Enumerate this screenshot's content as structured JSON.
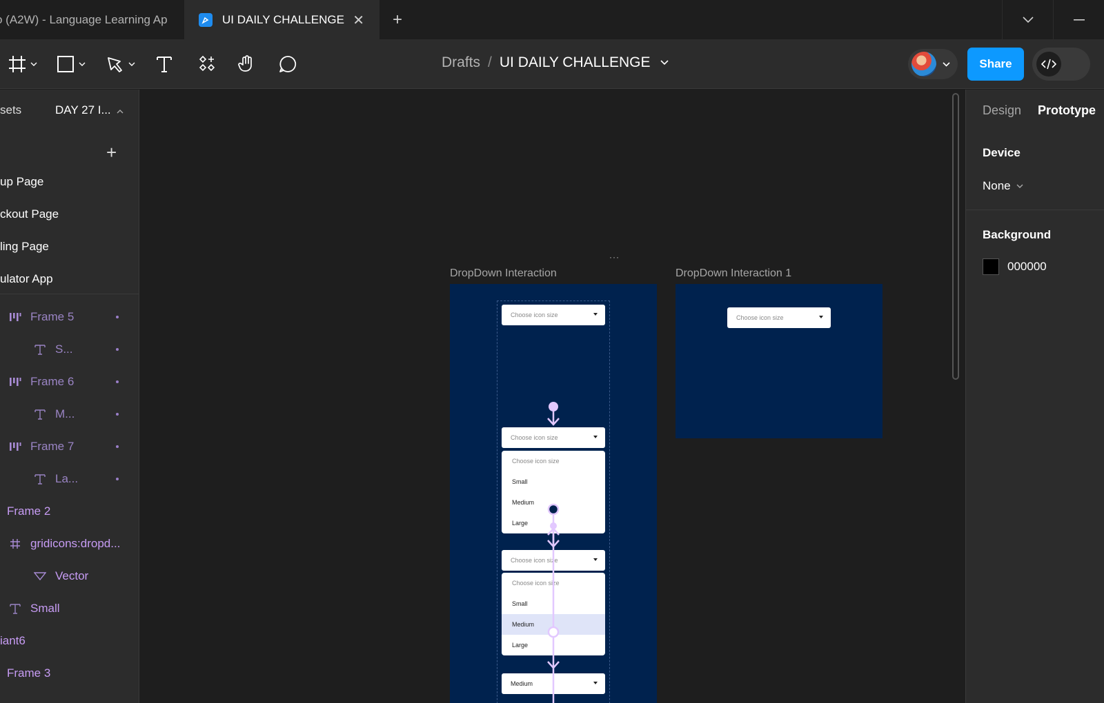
{
  "tabs": [
    {
      "label": "o (A2W) - Language Learning Ap"
    },
    {
      "label": "UI DAILY CHALLENGE",
      "close": "✕"
    }
  ],
  "new_tab": "+",
  "toolbar": {
    "breadcrumb_parent": "Drafts",
    "breadcrumb_sep": "/",
    "file_name": "UI DAILY CHALLENGE",
    "share_label": "Share"
  },
  "left_panel": {
    "header_left": "sets",
    "header_page": "DAY 27 I...",
    "add_icon": "+",
    "pages": [
      "up Page",
      "ckout Page",
      "ling Page",
      "ulator App"
    ],
    "layers": [
      {
        "label": "Frame 5",
        "icon": "auto-layout-icon"
      },
      {
        "label": "S...",
        "icon": "text-icon"
      },
      {
        "label": "Frame 6",
        "icon": "auto-layout-icon"
      },
      {
        "label": "M...",
        "icon": "text-icon"
      },
      {
        "label": "Frame 7",
        "icon": "auto-layout-icon"
      },
      {
        "label": "La...",
        "icon": "text-icon"
      },
      {
        "label": "Frame 2",
        "icon": "none"
      },
      {
        "label": "gridicons:dropd...",
        "icon": "frame-icon"
      },
      {
        "label": "Vector",
        "icon": "vector-icon"
      },
      {
        "label": "Small",
        "icon": "text-icon"
      },
      {
        "label": "iant6",
        "icon": "none"
      },
      {
        "label": "Frame 3",
        "icon": "none"
      }
    ]
  },
  "canvas": {
    "frame1_label": "DropDown Interaction",
    "frame2_label": "DropDown Interaction 1",
    "dots": "···",
    "dropdown_placeholder": "Choose icon size",
    "dropdown_selected_value": "Medium",
    "menu_options": [
      "Choose icon size",
      "Small",
      "Medium",
      "Large"
    ]
  },
  "right_panel": {
    "tab_design": "Design",
    "tab_prototype": "Prototype",
    "device_label": "Device",
    "device_value": "None",
    "background_label": "Background",
    "background_value": "000000"
  },
  "colors": {
    "accent": "#0d99ff",
    "frame_bg": "#00224e",
    "wire": "#e2c8ff",
    "layer_purple": "#c79cf4"
  }
}
